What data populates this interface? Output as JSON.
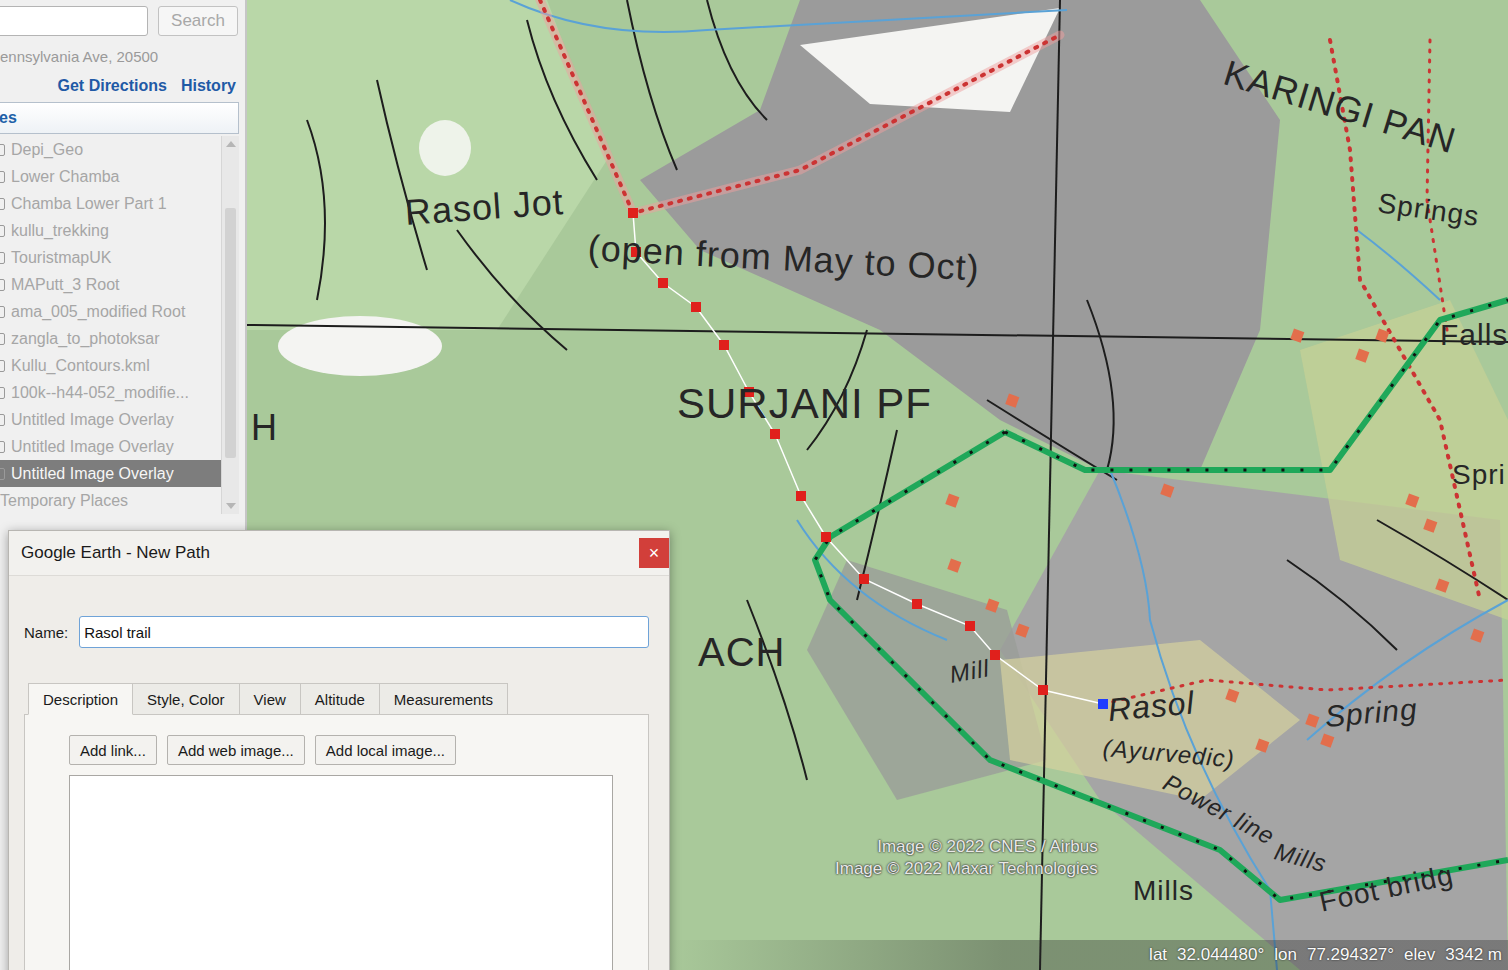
{
  "window": {
    "app": "Google Earth"
  },
  "sidebar": {
    "search": {
      "value": "",
      "button": "Search",
      "disabled": true
    },
    "address": "ennsylvania Ave, 20500",
    "links": [
      "Get Directions",
      "History"
    ],
    "places_header": "es",
    "items": [
      {
        "label": "Depi_Geo",
        "selected": false
      },
      {
        "label": "Lower Chamba",
        "selected": false
      },
      {
        "label": "Chamba Lower Part 1",
        "selected": false
      },
      {
        "label": "kullu_trekking",
        "selected": false
      },
      {
        "label": "TouristmapUK",
        "selected": false
      },
      {
        "label": "MAPutt_3 Root",
        "selected": false
      },
      {
        "label": "ama_005_modified Root",
        "selected": false
      },
      {
        "label": "zangla_to_photoksar",
        "selected": false
      },
      {
        "label": "Kullu_Contours.kml",
        "selected": false
      },
      {
        "label": "100k--h44-052_modifie...",
        "selected": false
      },
      {
        "label": "Untitled Image Overlay",
        "selected": false
      },
      {
        "label": "Untitled Image Overlay",
        "selected": false
      },
      {
        "label": "Untitled Image Overlay",
        "selected": true
      }
    ],
    "temporary": "Temporary Places"
  },
  "map": {
    "labels": [
      {
        "text": "Rasol Jot"
      },
      {
        "text": "(open from May to Oct)"
      },
      {
        "text": "SURJANI PF"
      },
      {
        "text": "ACH"
      },
      {
        "text": "KARINGI PAN"
      },
      {
        "text": "Springs"
      },
      {
        "text": "Falls"
      },
      {
        "text": "Spri"
      },
      {
        "text": "Spring"
      },
      {
        "text": "Mill"
      },
      {
        "text": "Rasol"
      },
      {
        "text": "(Ayurvedic)"
      },
      {
        "text": "Power line"
      },
      {
        "text": "Mills"
      },
      {
        "text": "Mills"
      },
      {
        "text": "Foot bridg"
      },
      {
        "text": "H"
      }
    ],
    "attribution": [
      "Image © 2022 CNES / Airbus",
      "Image © 2022 Maxar Technologies"
    ],
    "status": [
      {
        "label": "lat",
        "value": "32.044480°"
      },
      {
        "label": "lon",
        "value": "77.294327°"
      },
      {
        "label": "elev",
        "value": "3342 m"
      }
    ]
  },
  "dialog": {
    "title": "Google Earth - New Path",
    "close": "×",
    "name_label": "Name:",
    "name_value": "Rasol trail",
    "tabs": [
      {
        "label": "Description",
        "selected": true
      },
      {
        "label": "Style, Color",
        "selected": false
      },
      {
        "label": "View",
        "selected": false
      },
      {
        "label": "Altitude",
        "selected": false
      },
      {
        "label": "Measurements",
        "selected": false
      }
    ],
    "buttons": [
      "Add link...",
      "Add web image...",
      "Add local image..."
    ],
    "description": ""
  }
}
